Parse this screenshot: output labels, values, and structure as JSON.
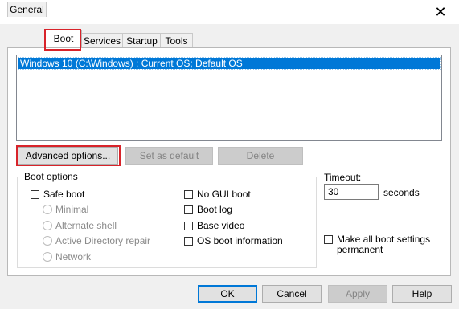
{
  "window": {
    "close_glyph": "✕",
    "icon": "msconfig-app-icon"
  },
  "tabs": [
    {
      "label": "General"
    },
    {
      "label": "Boot"
    },
    {
      "label": "Services"
    },
    {
      "label": "Startup"
    },
    {
      "label": "Tools"
    }
  ],
  "active_tab": "Boot",
  "boot_list": {
    "items": [
      "Windows 10 (C:\\Windows) : Current OS; Default OS"
    ]
  },
  "buttons": {
    "advanced": "Advanced options...",
    "set_default": "Set as default",
    "delete": "Delete"
  },
  "boot_options": {
    "title": "Boot options",
    "safe_boot": "Safe boot",
    "minimal": "Minimal",
    "alternate_shell": "Alternate shell",
    "ad_repair": "Active Directory repair",
    "network": "Network",
    "no_gui": "No GUI boot",
    "boot_log": "Boot log",
    "base_video": "Base video",
    "os_boot_info": "OS boot information"
  },
  "timeout": {
    "label": "Timeout:",
    "value": "30",
    "unit": "seconds"
  },
  "make_permanent": {
    "line1": "Make all boot settings",
    "line2": "permanent"
  },
  "footer": {
    "ok": "OK",
    "cancel": "Cancel",
    "apply": "Apply",
    "help": "Help"
  },
  "colors": {
    "selection": "#0078d7",
    "highlight_box": "#d8232a"
  }
}
